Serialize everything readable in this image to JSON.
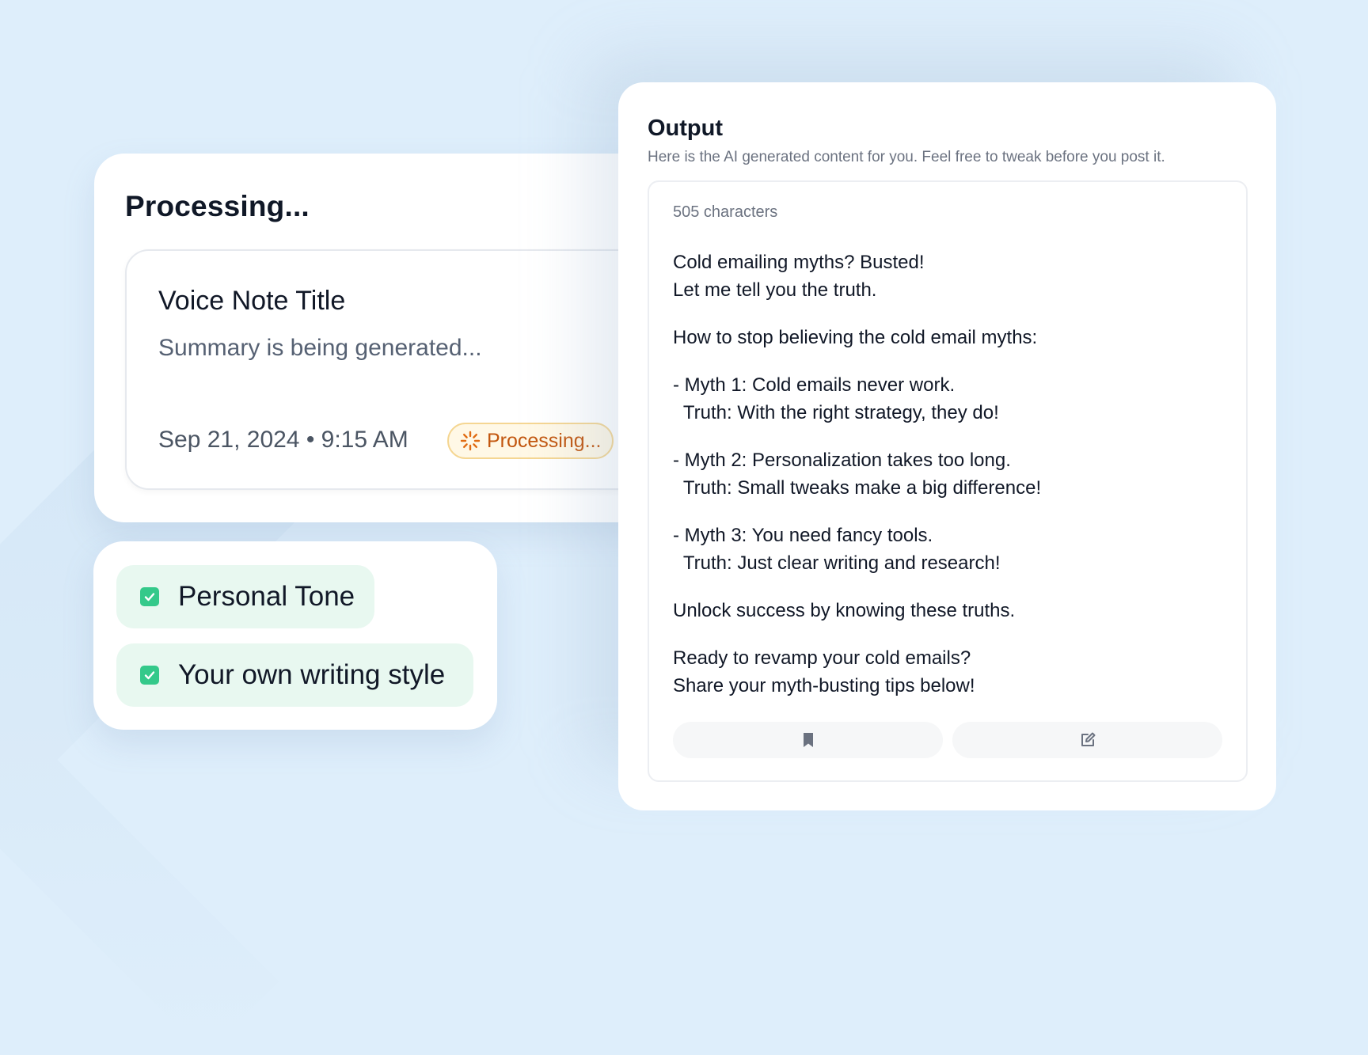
{
  "processing_panel": {
    "heading": "Processing...",
    "note": {
      "title": "Voice Note Title",
      "summary": "Summary is being generated...",
      "date": "Sep 21, 2024 • 9:15 AM",
      "status": "Processing..."
    }
  },
  "options": [
    {
      "label": "Personal Tone",
      "checked": true
    },
    {
      "label": "Your own writing style",
      "checked": true
    }
  ],
  "output_panel": {
    "title": "Output",
    "subtitle": "Here is the AI generated content for you. Feel free to tweak before you post it.",
    "char_count": "505 characters",
    "paragraphs": [
      "Cold emailing myths? Busted!\nLet me tell you the truth.",
      "How to stop believing the cold email myths:",
      "- Myth 1: Cold emails never work.\n  Truth: With the right strategy, they do!",
      "- Myth 2: Personalization takes too long.\n  Truth: Small tweaks make a big difference!",
      "- Myth 3: You need fancy tools.\n  Truth: Just clear writing and research!",
      "Unlock success by knowing these truths.",
      "Ready to revamp your cold emails?\nShare your myth-busting tips below!"
    ],
    "actions": [
      {
        "icon": "bookmark-icon"
      },
      {
        "icon": "edit-icon"
      }
    ]
  },
  "colors": {
    "background": "#deeefb",
    "processing_badge_text": "#c2560e",
    "processing_badge_border": "#f5d692",
    "option_bg": "#e8f8f0",
    "check_green": "#34c98a"
  }
}
